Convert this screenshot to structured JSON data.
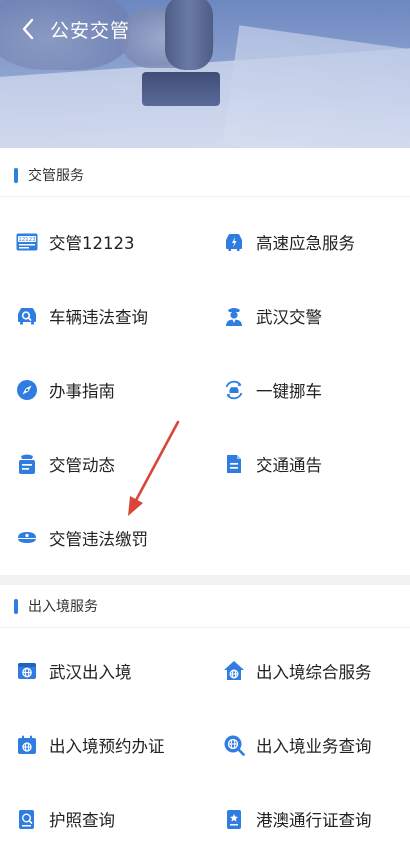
{
  "header": {
    "title": "公安交管"
  },
  "sections": [
    {
      "title": "交管服务",
      "items": [
        {
          "label": "交管12123",
          "icon": "12123-badge-icon"
        },
        {
          "label": "高速应急服务",
          "icon": "car-emergency-icon"
        },
        {
          "label": "车辆违法查询",
          "icon": "car-search-icon"
        },
        {
          "label": "武汉交警",
          "icon": "police-officer-icon"
        },
        {
          "label": "办事指南",
          "icon": "compass-icon"
        },
        {
          "label": "一键挪车",
          "icon": "car-move-icon"
        },
        {
          "label": "交管动态",
          "icon": "police-news-icon"
        },
        {
          "label": "交通通告",
          "icon": "notice-document-icon"
        },
        {
          "label": "交管违法缴罚",
          "icon": "police-cap-icon"
        }
      ]
    },
    {
      "title": "出入境服务",
      "items": [
        {
          "label": "武汉出入境",
          "icon": "globe-card-icon"
        },
        {
          "label": "出入境综合服务",
          "icon": "globe-house-icon"
        },
        {
          "label": "出入境预约办证",
          "icon": "calendar-globe-icon"
        },
        {
          "label": "出入境业务查询",
          "icon": "globe-search-icon"
        },
        {
          "label": "护照查询",
          "icon": "passport-search-icon"
        },
        {
          "label": "港澳通行证查询",
          "icon": "permit-document-icon"
        }
      ]
    }
  ],
  "colors": {
    "accent": "#2f7de1",
    "icon_blue": "#2f7de1",
    "annotation_arrow": "#d9453a"
  }
}
